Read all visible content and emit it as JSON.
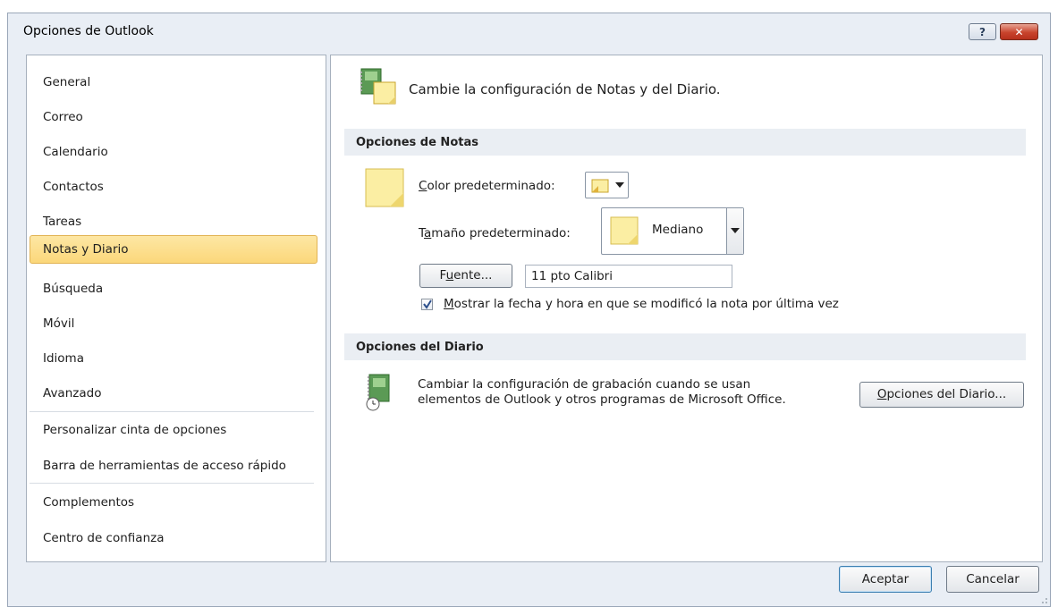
{
  "window": {
    "title": "Opciones de Outlook",
    "help_glyph": "?",
    "close_glyph": "✕"
  },
  "nav": {
    "items": [
      {
        "label": "General"
      },
      {
        "label": "Correo"
      },
      {
        "label": "Calendario"
      },
      {
        "label": "Contactos"
      },
      {
        "label": "Tareas"
      },
      {
        "label": "Notas y Diario",
        "selected": true
      },
      {
        "label": "Búsqueda"
      },
      {
        "label": "Móvil"
      },
      {
        "label": "Idioma"
      },
      {
        "label": "Avanzado"
      },
      {
        "label": "Personalizar cinta de opciones"
      },
      {
        "label": "Barra de herramientas de acceso rápido"
      },
      {
        "label": "Complementos"
      },
      {
        "label": "Centro de confianza"
      }
    ]
  },
  "main": {
    "header": "Cambie la configuración de Notas y del Diario.",
    "notes_section": {
      "title": "Opciones de Notas",
      "color_label_hotkey": "C",
      "color_label_rest": "olor predeterminado:",
      "size_label_pre": "T",
      "size_label_hotkey": "a",
      "size_label_rest": "maño predeterminado:",
      "size_value": "Mediano",
      "font_button_pre": "F",
      "font_button_hotkey": "u",
      "font_button_rest": "ente...",
      "font_value": "11 pto Calibri",
      "show_date_hotkey": "M",
      "show_date_rest": "ostrar la fecha y hora en que se modificó la nota por última vez",
      "show_date_checked": true
    },
    "journal_section": {
      "title": "Opciones del Diario",
      "description_line1": "Cambiar la configuración de grabación cuando se usan",
      "description_line2": "elementos de Outlook y otros programas de Microsoft Office.",
      "button_hotkey": "O",
      "button_rest": "pciones del Diario..."
    }
  },
  "footer": {
    "ok_label": "Aceptar",
    "cancel_label": "Cancelar"
  },
  "colors": {
    "note_yellow": "#fbeea3",
    "selection": "#fbd77a",
    "journal_green": "#5b9a55"
  }
}
